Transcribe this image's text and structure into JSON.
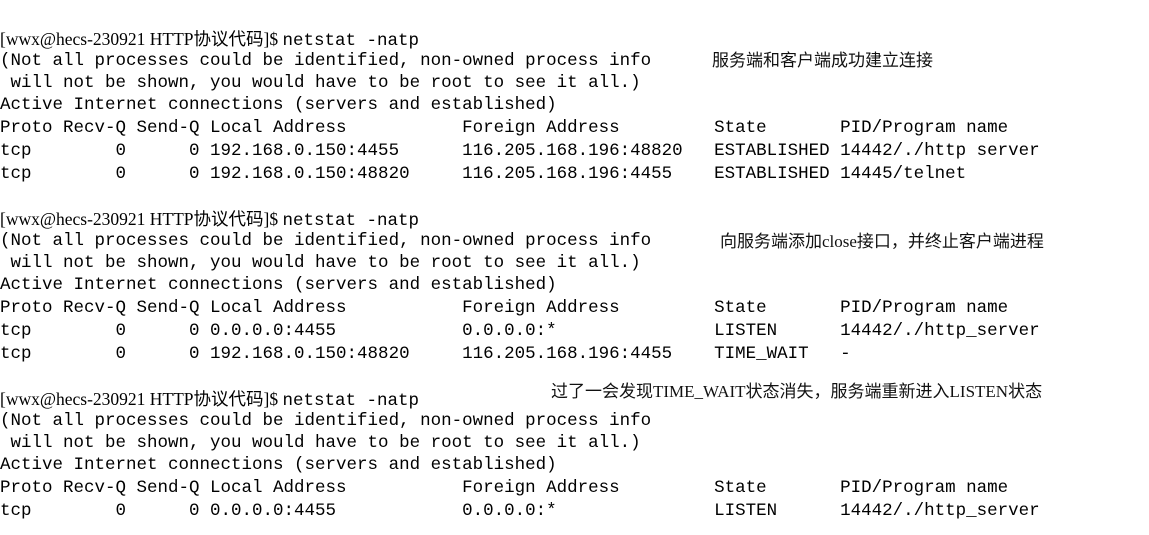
{
  "terminal": {
    "prompt": "[wwx@hecs-230921 HTTP协议代码]$ ",
    "command": "netstat -natp",
    "warning_line_1": "(Not all processes could be identified, non-owned process info",
    "warning_line_2": " will not be shown, you would have to be root to see it all.)",
    "active_header": "Active Internet connections (servers and established)",
    "column_header": "Proto Recv-Q Send-Q Local Address           Foreign Address         State       PID/Program name",
    "blocks": [
      {
        "id": "block-1",
        "rows": [
          "tcp        0      0 192.168.0.150:4455      116.205.168.196:48820   ESTABLISHED 14442/./http server",
          "tcp        0      0 192.168.0.150:48820     116.205.168.196:4455    ESTABLISHED 14445/telnet"
        ],
        "annotation": "服务端和客户端成功建立连接"
      },
      {
        "id": "block-2",
        "rows": [
          "tcp        0      0 0.0.0.0:4455            0.0.0.0:*               LISTEN      14442/./http_server",
          "tcp        0      0 192.168.0.150:48820     116.205.168.196:4455    TIME_WAIT   -"
        ],
        "annotation": "向服务端添加close接口，并终止客户端进程"
      },
      {
        "id": "block-3",
        "rows": [
          "tcp        0      0 0.0.0.0:4455            0.0.0.0:*               LISTEN      14442/./http_server"
        ],
        "annotation": "过了一会发现TIME_WAIT状态消失，服务端重新进入LISTEN状态"
      }
    ]
  },
  "colors": {
    "background": "#ffffff",
    "text": "#000000",
    "annotation": "#111111"
  }
}
